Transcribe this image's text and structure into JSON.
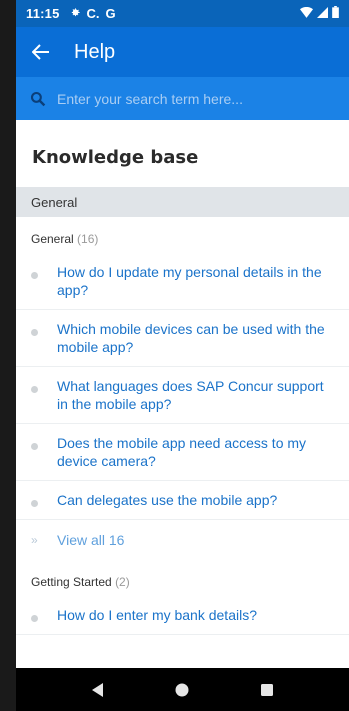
{
  "status_bar": {
    "time": "11:15",
    "left_icons": [
      "settings-icon",
      "c-icon",
      "g-icon"
    ],
    "right_icons": [
      "wifi-icon",
      "signal-icon",
      "battery-icon"
    ]
  },
  "app_bar": {
    "title": "Help"
  },
  "search": {
    "placeholder": "Enter your search term here..."
  },
  "main": {
    "title": "Knowledge base",
    "section_label": "General",
    "groups": [
      {
        "name": "General",
        "count": "(16)",
        "items": [
          "How do I update my personal details in the app?",
          "Which mobile devices can be used with the mobile app?",
          "What languages does SAP Concur support in the mobile app?",
          "Does the mobile app need access to my device camera?",
          "Can delegates use the mobile app?"
        ],
        "view_all": "View all 16"
      },
      {
        "name": "Getting Started",
        "count": "(2)",
        "items": [
          "How do I enter my bank details?"
        ]
      }
    ]
  },
  "nav_bar": {
    "buttons": [
      "back-triangle-icon",
      "home-circle-icon",
      "recents-square-icon"
    ]
  },
  "colors": {
    "status_bar": "#0a64b9",
    "app_bar": "#0a6ed6",
    "search_bar": "#1b82e6",
    "link": "#1b73c9",
    "section_bar": "#e0e4e8"
  }
}
